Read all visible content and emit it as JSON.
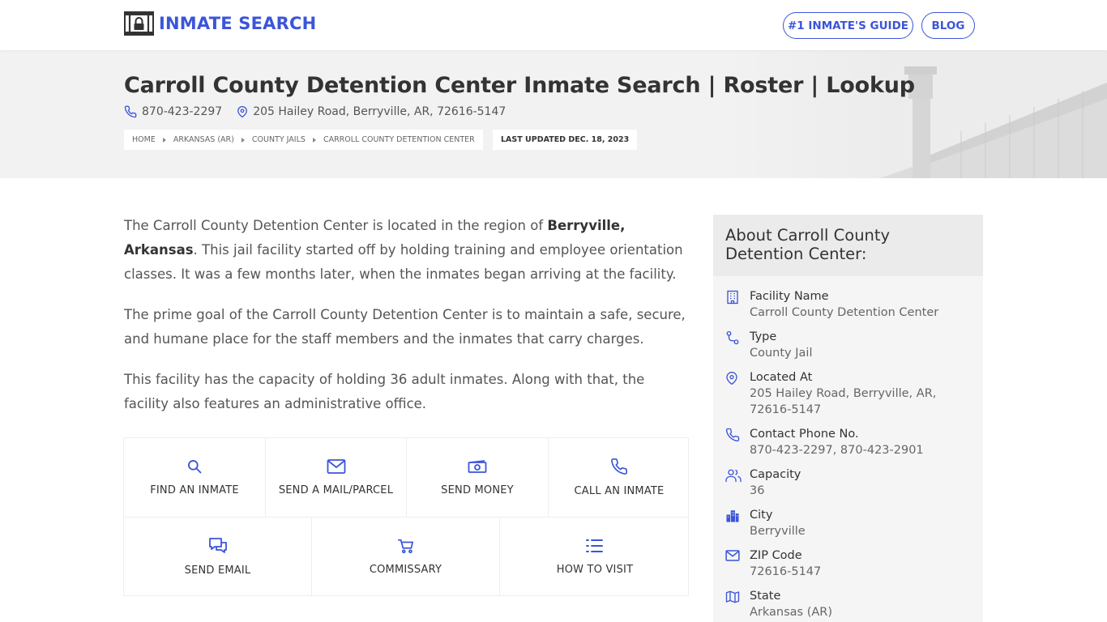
{
  "header": {
    "logo_text": "INMATE SEARCH",
    "nav": [
      "#1 INMATE'S GUIDE",
      "BLOG"
    ]
  },
  "hero": {
    "title": "Carroll County Detention Center Inmate Search | Roster | Lookup",
    "phone": "870-423-2297",
    "address": "205 Hailey Road, Berryville, AR, 72616-5147",
    "breadcrumb": [
      "HOME",
      "ARKANSAS (AR)",
      "COUNTY JAILS",
      "CARROLL COUNTY DETENTION CENTER"
    ],
    "last_updated": "LAST UPDATED DEC. 18, 2023"
  },
  "content": {
    "p1_before": "The Carroll County Detention Center is located in the region of ",
    "p1_bold": "Berryville, Arkansas",
    "p1_after": ". This jail facility started off by holding training and employee orientation classes. It was a few months later, when the inmates began arriving at the facility.",
    "p2": "The prime goal of the Carroll County Detention Center is to maintain a safe, secure, and humane place for the staff members and the inmates that carry charges.",
    "p3": "This facility has the capacity of holding 36 adult inmates. Along with that, the facility also features an administrative office."
  },
  "actions": [
    {
      "label": "FIND AN INMATE",
      "icon": "search-icon"
    },
    {
      "label": "SEND A MAIL/PARCEL",
      "icon": "mail-icon"
    },
    {
      "label": "SEND MONEY",
      "icon": "money-icon"
    },
    {
      "label": "CALL AN INMATE",
      "icon": "phone-icon"
    },
    {
      "label": "SEND EMAIL",
      "icon": "chat-icon"
    },
    {
      "label": "COMMISSARY",
      "icon": "cart-icon"
    },
    {
      "label": "HOW TO VISIT",
      "icon": "list-icon"
    }
  ],
  "sidebar": {
    "title": "About Carroll County Detention Center:",
    "items": [
      {
        "key": "Facility Name",
        "value": "Carroll County Detention Center",
        "icon": "building-icon"
      },
      {
        "key": "Type",
        "value": "County Jail",
        "icon": "route-icon"
      },
      {
        "key": "Located At",
        "value": "205 Hailey Road, Berryville, AR, 72616-5147",
        "icon": "location-icon"
      },
      {
        "key": "Contact Phone No.",
        "value": "870-423-2297, 870-423-2901",
        "icon": "phone-icon"
      },
      {
        "key": "Capacity",
        "value": "36",
        "icon": "users-icon"
      },
      {
        "key": "City",
        "value": "Berryville",
        "icon": "city-icon"
      },
      {
        "key": "ZIP Code",
        "value": "72616-5147",
        "icon": "mail-icon"
      },
      {
        "key": "State",
        "value": "Arkansas (AR)",
        "icon": "map-icon"
      }
    ]
  },
  "colors": {
    "accent": "#3b55d9",
    "hero_bg": "#f2f2f2",
    "sidebar_bg": "#f5f5f5"
  }
}
